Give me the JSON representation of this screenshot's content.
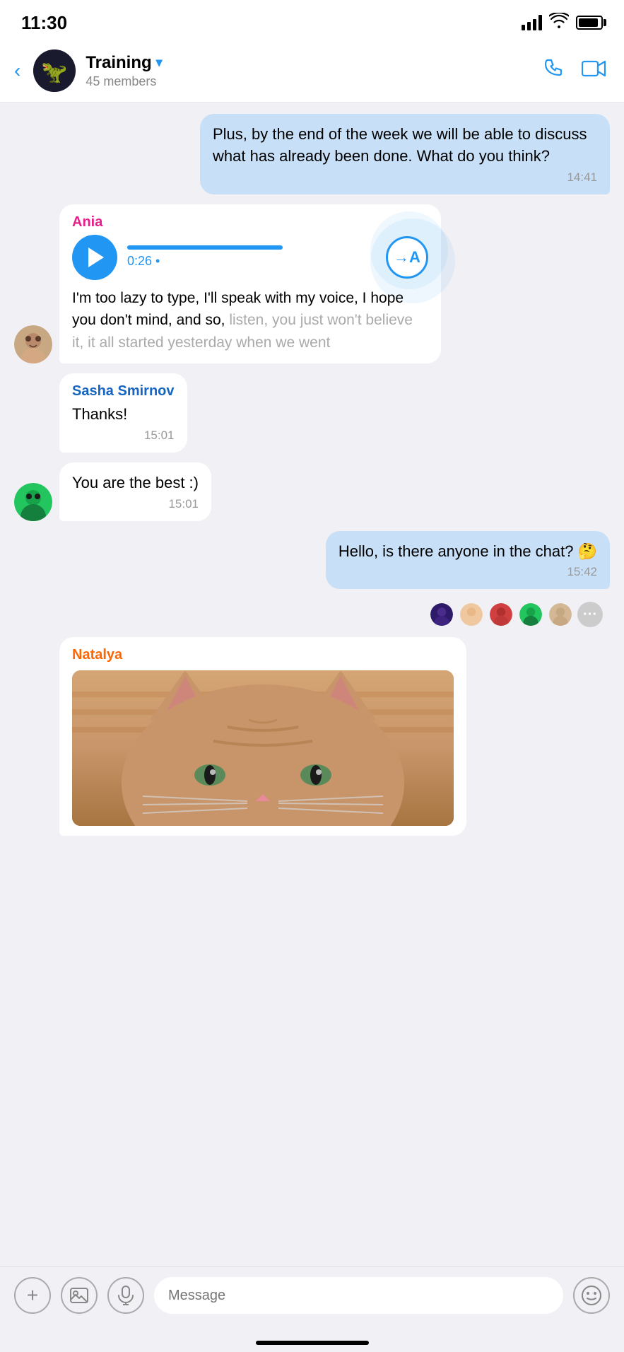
{
  "status_bar": {
    "time": "11:30"
  },
  "header": {
    "back_label": "‹",
    "group_name": "Training",
    "group_name_chevron": "⌄",
    "members_count": "45 members",
    "group_avatar_emoji": "🦖",
    "call_icon": "phone",
    "video_icon": "video"
  },
  "messages": [
    {
      "id": "msg1",
      "type": "outgoing",
      "text": "Plus, by the end of the week we will be able to discuss what has already been done.\nWhat do you think?",
      "time": "14:41"
    },
    {
      "id": "msg2",
      "type": "incoming_voice",
      "sender": "Ania",
      "sender_class": "ania",
      "duration": "0:26",
      "duration_dot": "0:26 •",
      "translate_label": "→A",
      "transcript": "I'm too lazy to type, I'll speak with my voice, I hope you don't mind, and so, listen, you just won't believe it, it all started yesterday when we went"
    },
    {
      "id": "msg3",
      "type": "incoming",
      "sender": "Sasha Smirnov",
      "sender_class": "sasha",
      "text": "Thanks!",
      "time": "15:01"
    },
    {
      "id": "msg4",
      "type": "incoming_no_sender",
      "text": "You are the best :)",
      "time": "15:01"
    },
    {
      "id": "msg5",
      "type": "outgoing",
      "text": "Hello, is there anyone in the chat? 🤔",
      "time": "15:42"
    },
    {
      "id": "msg6",
      "type": "viewers",
      "avatars": [
        "dark_avatar",
        "light_avatar",
        "red_avatar",
        "green_avatar",
        "beige_avatar"
      ],
      "more_label": "···"
    },
    {
      "id": "msg7",
      "type": "incoming_image",
      "sender": "Natalya",
      "sender_class": "natalya",
      "image_alt": "cat photo"
    }
  ],
  "input_bar": {
    "add_icon": "+",
    "image_icon": "🖼",
    "mic_icon": "🎙",
    "placeholder": "Message",
    "emoji_icon": "🙂"
  }
}
